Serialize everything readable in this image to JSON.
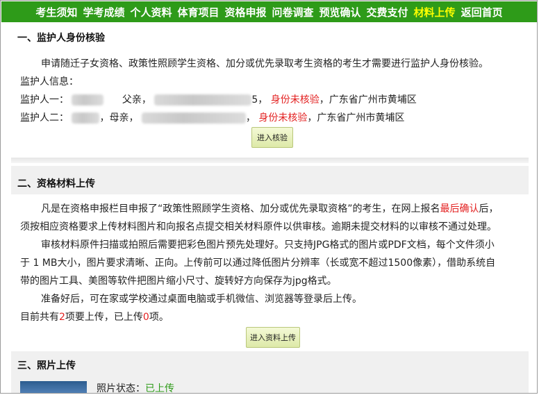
{
  "nav": {
    "items": [
      "考生须知",
      "学考成绩",
      "个人资料",
      "体育项目",
      "资格申报",
      "问卷调查",
      "预览确认",
      "交费支付",
      "材料上传",
      "返回首页"
    ],
    "active_index": 8
  },
  "section1": {
    "title": "一、监护人身份核验",
    "intro": "申请随迁子女资格、政策性照顾学生资格、加分或优先录取考生资格的考生才需要进行监护人身份核验。",
    "guardian_info_label": "监护人信息：",
    "guardian1": {
      "label": "监护人一：",
      "relation": "父亲，",
      "id_suffix": "5，",
      "status": "身份未核验",
      "location": "，广东省广州市黄埔区"
    },
    "guardian2": {
      "label": "监护人二：",
      "relation": "，母亲，",
      "id_suffix": "，",
      "status": "身份未核验",
      "location": "，广东省广州市黄埔区"
    },
    "verify_button": "进入核验"
  },
  "section2": {
    "title": "二、资格材料上传",
    "p1_a": "凡是在资格申报栏目申报了“政策性照顾学生资格、加分或优先录取资格”的考生，在网上报名",
    "p1_highlight": "最后确认",
    "p1_b": "后，",
    "p1_line2": "须按相应资格要求上传材料图片和向报名点提交相关材料原件以供审核。逾期未提交材料的以审核不通过处理。",
    "p2_line1": "审核材料原件扫描或拍照后需要把彩色图片预先处理好。只支持JPG格式的图片或PDF文档，每个文件须小",
    "p2_line2": "于 1 MB大小，图片要求清晰、正向。上传前可以通过降低图片分辨率（长或宽不超过1500像素），借助系统自",
    "p2_line3": "带的图片工具、美图等软件把图片缩小尺寸、旋转好方向保存为jpg格式。",
    "p3": "准备好后，可在家或学校通过桌面电脑或手机微信、浏览器等登录后上传。",
    "count_a": "目前共有",
    "count_required": "2",
    "count_b": "项要上传，已上传",
    "count_uploaded": "0",
    "count_c": "项。",
    "upload_button": "进入资料上传"
  },
  "section3": {
    "title": "三、照片上传",
    "photo_status_label": "照片状态：",
    "photo_status_value": "已上传"
  }
}
